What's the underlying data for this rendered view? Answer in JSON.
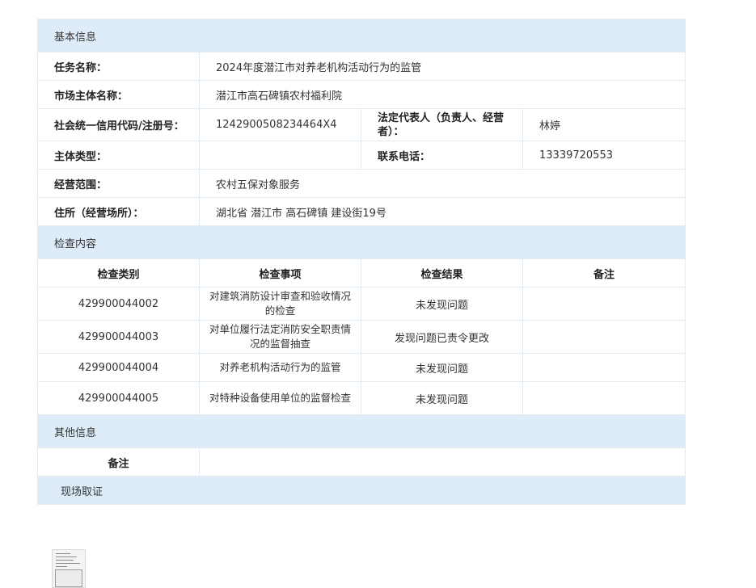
{
  "basic": {
    "section_title": "基本信息",
    "task_name_label": "任务名称：",
    "task_name_value": "2024年度潜江市对养老机构活动行为的监管",
    "entity_name_label": "市场主体名称：",
    "entity_name_value": "潜江市高石碑镇农村福利院",
    "credit_code_label": "社会统一信用代码/注册号：",
    "credit_code_value": "1242900508234464X4",
    "legal_rep_label": "法定代表人（负责人、经营者）：",
    "legal_rep_value": "林婷",
    "entity_type_label": "主体类型：",
    "entity_type_value": "",
    "phone_label": "联系电话：",
    "phone_value": "13339720553",
    "scope_label": "经营范围：",
    "scope_value": "农村五保对象服务",
    "address_label": "住所（经营场所）：",
    "address_value": "湖北省 潜江市 高石碑镇 建设街19号"
  },
  "inspection": {
    "section_title": "检查内容",
    "headers": [
      "检查类别",
      "检查事项",
      "检查结果",
      "备注"
    ],
    "rows": [
      {
        "category": "429900044002",
        "item": "对建筑消防设计审查和验收情况的检查",
        "result": "未发现问题",
        "note": ""
      },
      {
        "category": "429900044003",
        "item": "对单位履行法定消防安全职责情况的监督抽查",
        "result": "发现问题已责令更改",
        "note": ""
      },
      {
        "category": "429900044004",
        "item": "对养老机构活动行为的监管",
        "result": "未发现问题",
        "note": ""
      },
      {
        "category": "429900044005",
        "item": "对特种设备使用单位的监督检查",
        "result": "未发现问题",
        "note": ""
      }
    ]
  },
  "other": {
    "section_title": "其他信息",
    "note_label": "备注",
    "note_value": ""
  },
  "evidence": {
    "section_title": "现场取证"
  },
  "colors": {
    "section_bg": "#ddecf8",
    "border": "#e3ecf4"
  }
}
